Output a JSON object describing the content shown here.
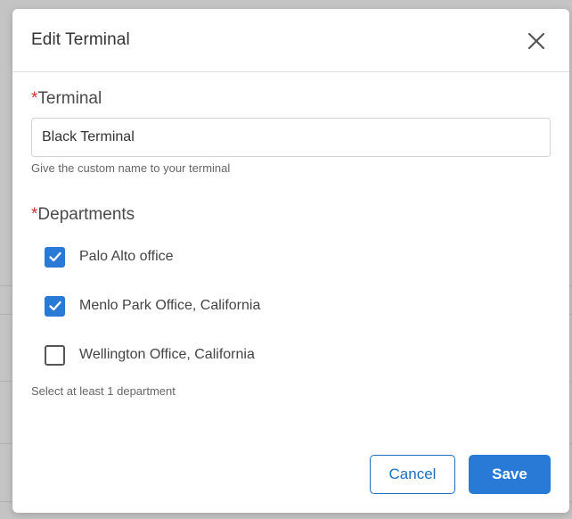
{
  "modal": {
    "title": "Edit Terminal",
    "close_icon": "close-icon"
  },
  "terminal": {
    "required_mark": "*",
    "label": "Terminal",
    "value": "Black Terminal",
    "hint": "Give the custom name to your terminal"
  },
  "departments": {
    "required_mark": "*",
    "label": "Departments",
    "items": [
      {
        "label": "Palo Alto office",
        "checked": true
      },
      {
        "label": "Menlo Park Office, California",
        "checked": true
      },
      {
        "label": "Wellington Office, California",
        "checked": false
      }
    ],
    "hint": "Select at least 1 department"
  },
  "actions": {
    "cancel_label": "Cancel",
    "save_label": "Save"
  },
  "colors": {
    "primary": "#2979d6",
    "required": "#d0342c"
  }
}
